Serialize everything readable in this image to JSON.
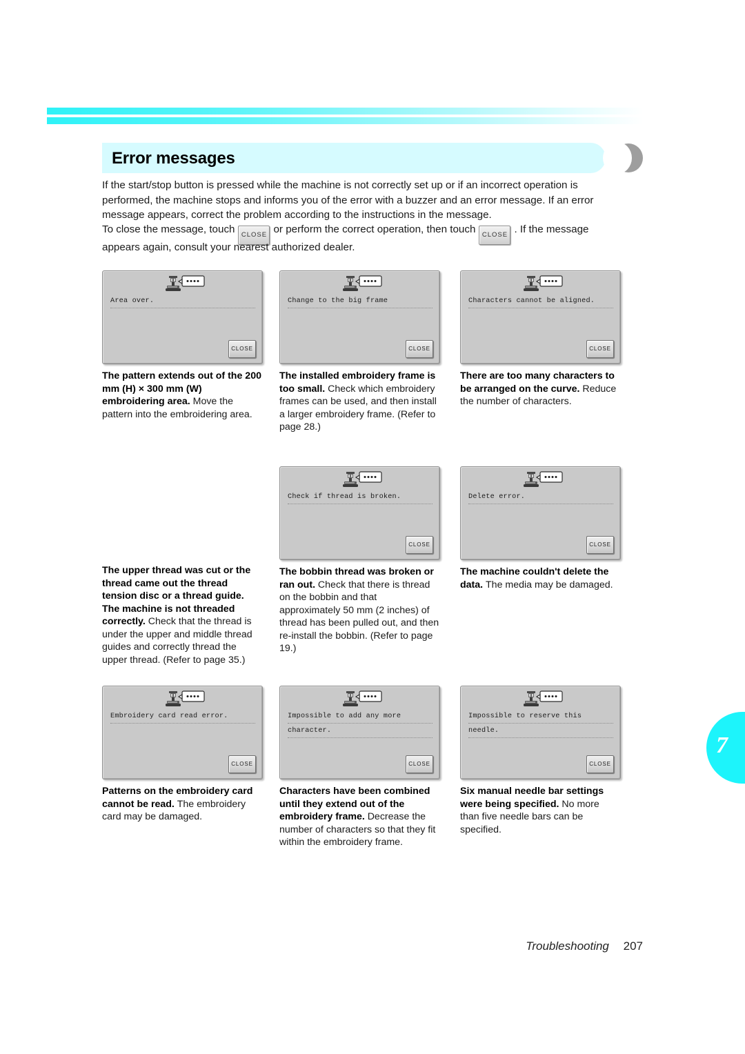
{
  "section": {
    "title": "Error messages",
    "accent_color": "#1df4fb",
    "title_band_color": "#d6fbff"
  },
  "intro": {
    "paragraph1": "If the start/stop button is pressed while the machine is not correctly set up or if an incorrect operation is performed, the machine stops and informs you of the error with a buzzer and an error message. If an error message appears, correct the problem according to the instructions in the message.",
    "line2_before": "To close the message, touch",
    "close_label": "CLOSE",
    "line2_middle": "or perform the correct operation, then touch",
    "line2_after": ". If the message",
    "line3": "appears again, consult your nearest authorized dealer."
  },
  "dialog_close_label": "CLOSE",
  "rows": [
    {
      "cells": [
        {
          "has_dialog": true,
          "message_lines": [
            "Area over."
          ],
          "title": "The pattern extends out of the 200 mm (H) × 300 mm (W) embroidering area.",
          "body": "Move the pattern into the embroidering area."
        },
        {
          "has_dialog": true,
          "message_lines": [
            "Change to the big frame"
          ],
          "title": "The installed embroidery frame is too small.",
          "body": "Check which embroidery frames can be used, and then install a larger embroidery frame. (Refer to page 28.)"
        },
        {
          "has_dialog": true,
          "message_lines": [
            "Characters cannot be aligned."
          ],
          "title": "There are too many characters to be arranged on the curve.",
          "body": "Reduce the number of characters."
        }
      ]
    },
    {
      "cells": [
        {
          "has_dialog": false,
          "message_lines": [],
          "title": "The upper thread was cut or the thread came out the thread tension disc or a thread guide. The machine is not threaded correctly.",
          "body": "Check that the thread is under the upper and middle thread guides and correctly thread the upper thread. (Refer to page 35.)"
        },
        {
          "has_dialog": true,
          "message_lines": [
            "Check if thread is broken."
          ],
          "title": "The bobbin thread was broken or ran out.",
          "body": "Check that there is thread on the bobbin and that approximately 50 mm (2 inches) of thread has been pulled out, and then re-install the bobbin. (Refer to page 19.)"
        },
        {
          "has_dialog": true,
          "message_lines": [
            "Delete error."
          ],
          "title": "The machine couldn't delete the data.",
          "body": "The media may be damaged."
        }
      ]
    },
    {
      "cells": [
        {
          "has_dialog": true,
          "message_lines": [
            "Embroidery card read error."
          ],
          "title": "Patterns on the embroidery card cannot be read.",
          "body": "The embroidery card may be damaged."
        },
        {
          "has_dialog": true,
          "message_lines": [
            "Impossible to add any more",
            "character."
          ],
          "title": "Characters have been combined until they extend out of the embroidery frame.",
          "body": "Decrease the number of characters so that they fit within the embroidery frame."
        },
        {
          "has_dialog": true,
          "message_lines": [
            "Impossible to reserve this",
            "needle."
          ],
          "title": "Six manual needle bar settings were being specified.",
          "body": "No more than five needle bars can be specified."
        }
      ]
    }
  ],
  "chapter": {
    "number": "7"
  },
  "footer": {
    "label": "Troubleshooting",
    "page": "207"
  }
}
